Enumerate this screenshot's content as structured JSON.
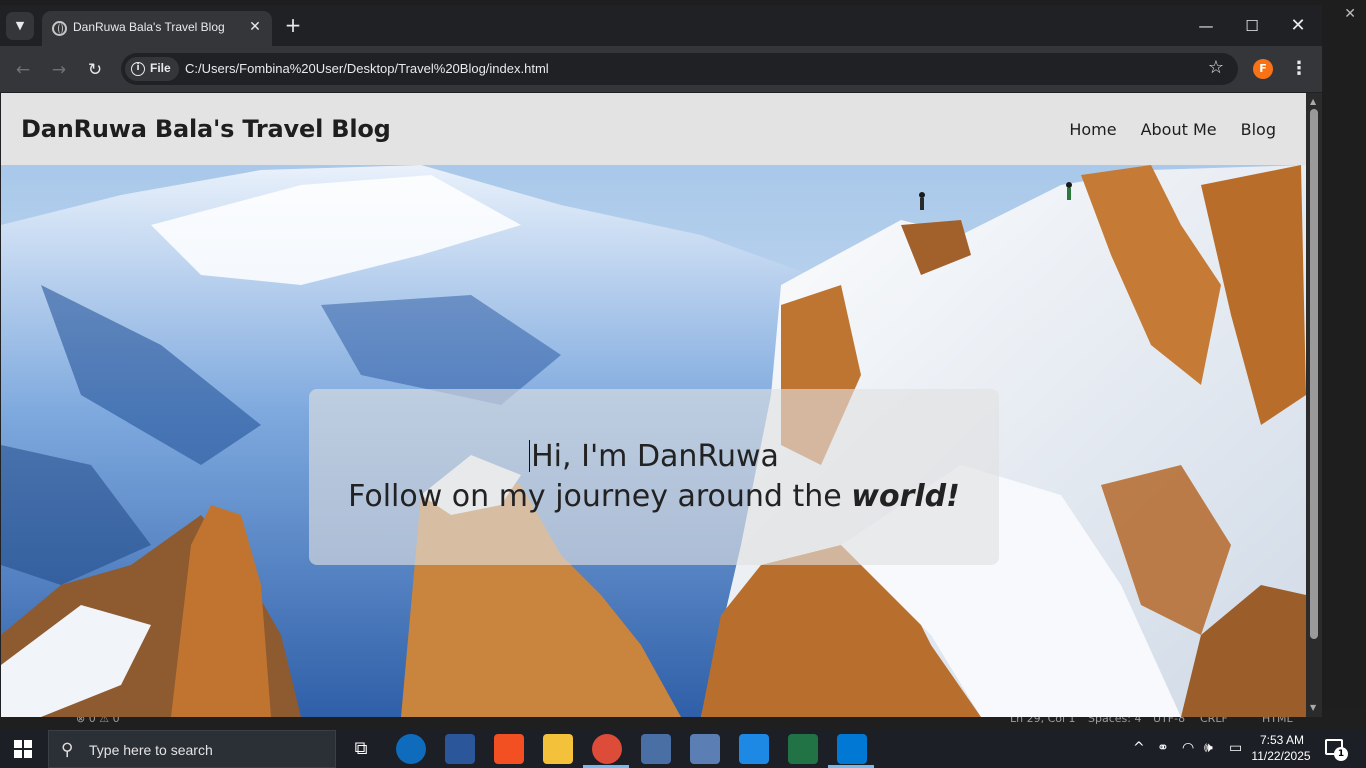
{
  "browser": {
    "tab_title": "DanRuwa Bala's Travel Blog",
    "security_label": "File",
    "url": "C:/Users/Fombina%20User/Desktop/Travel%20Blog/index.html",
    "profile_initial": "F"
  },
  "site": {
    "title": "DanRuwa Bala's Travel Blog",
    "nav": [
      "Home",
      "About Me",
      "Blog"
    ],
    "hero_line1": "Hi, I'm DanRuwa",
    "hero_line2_prefix": "Follow on my journey around the ",
    "hero_line2_emphasis": "world!"
  },
  "editor_status": {
    "problems": "0",
    "warnings": "0",
    "cursor": "Ln 29, Col 1",
    "spaces": "Spaces: 4",
    "encoding": "UTF-8",
    "eol": "CRLF",
    "language": "HTML"
  },
  "taskbar": {
    "search_placeholder": "Type here to search",
    "time": "7:53 AM",
    "date": "11/22/2025",
    "notification_count": "1"
  },
  "colors": {
    "accent_profile": "#f97316",
    "nav_bg": "#e3e3e3",
    "taskbar_active": "#76b9ed"
  }
}
